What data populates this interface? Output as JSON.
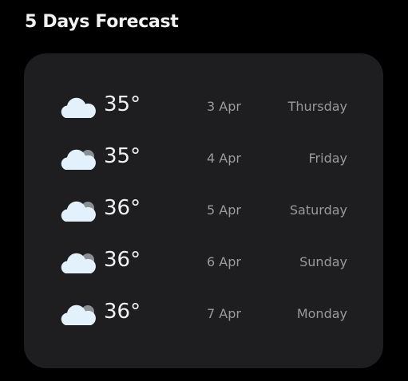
{
  "header": {
    "title": "5 Days Forecast"
  },
  "forecast": [
    {
      "icon": "cloud-icon",
      "temp": "35°",
      "date": "3 Apr",
      "day": "Thursday"
    },
    {
      "icon": "clouds-icon",
      "temp": "35°",
      "date": "4 Apr",
      "day": "Friday"
    },
    {
      "icon": "clouds-icon",
      "temp": "36°",
      "date": "5 Apr",
      "day": "Saturday"
    },
    {
      "icon": "clouds-icon",
      "temp": "36°",
      "date": "6 Apr",
      "day": "Sunday"
    },
    {
      "icon": "clouds-icon",
      "temp": "36°",
      "date": "7 Apr",
      "day": "Monday"
    }
  ],
  "colors": {
    "cloud": "#e3f1fd",
    "back_cloud": "#8a8f94",
    "card": "#1e1e20"
  }
}
